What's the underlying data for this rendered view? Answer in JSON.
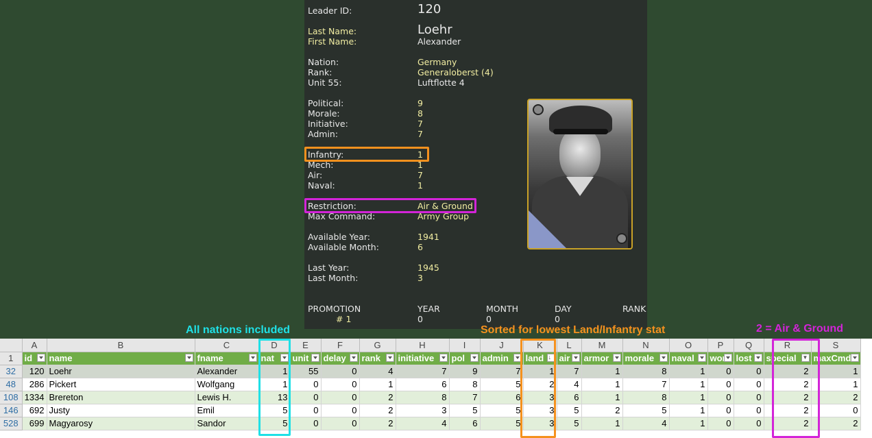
{
  "leader": {
    "leader_id_label": "Leader ID:",
    "leader_id": "120",
    "last_name_label": "Last Name:",
    "last_name": "Loehr",
    "first_name_label": "First Name:",
    "first_name": "Alexander",
    "nation_label": "Nation:",
    "nation": "Germany",
    "rank_label": "Rank:",
    "rank": "Generaloberst (4)",
    "unit_label": "Unit 55:",
    "unit": "Luftflotte 4",
    "political_label": "Political:",
    "political": "9",
    "morale_label": "Morale:",
    "morale": "8",
    "initiative_label": "Initiative:",
    "initiative": "7",
    "admin_label": "Admin:",
    "admin": "7",
    "infantry_label": "Infantry:",
    "infantry": "1",
    "mech_label": "Mech:",
    "mech": "1",
    "air_label": "Air:",
    "air": "7",
    "naval_label": "Naval:",
    "naval": "1",
    "restriction_label": "Restriction:",
    "restriction": "Air & Ground",
    "max_command_label": "Max Command:",
    "max_command": "Army Group",
    "avail_year_label": "Available Year:",
    "avail_year": "1941",
    "avail_month_label": "Available Month:",
    "avail_month": "6",
    "last_year_label": "Last Year:",
    "last_year": "1945",
    "last_month_label": "Last Month:",
    "last_month": "3",
    "promo_header": "PROMOTION",
    "year_header": "YEAR",
    "month_header": "MONTH",
    "day_header": "DAY",
    "rank_header": "RANK",
    "promo_num": "# 1",
    "promo_year": "0",
    "promo_month": "0",
    "promo_day": "0"
  },
  "annotations": {
    "nations": "All nations included",
    "sorted": "Sorted for lowest Land/Infantry stat",
    "special": "2 = Air & Ground"
  },
  "colors": {
    "orange": "#f5911e",
    "magenta": "#d324d8",
    "cyan": "#1fe0e6",
    "header_green": "#70ad47"
  },
  "sheet": {
    "column_letters": [
      "A",
      "B",
      "C",
      "D",
      "E",
      "F",
      "G",
      "H",
      "I",
      "J",
      "K",
      "L",
      "M",
      "N",
      "O",
      "P",
      "Q",
      "R",
      "S"
    ],
    "header_row_num": "1",
    "fields": [
      "id",
      "name",
      "fname",
      "nat",
      "unit",
      "delay",
      "rank",
      "initiative",
      "pol",
      "admin",
      "land",
      "air",
      "armor",
      "morale",
      "naval",
      "won",
      "lost",
      "special",
      "maxCmd"
    ],
    "rows": [
      {
        "rownum": "32",
        "cells": [
          "120",
          "Loehr",
          "Alexander",
          "1",
          "55",
          "0",
          "4",
          "7",
          "9",
          "7",
          "1",
          "7",
          "1",
          "8",
          "1",
          "0",
          "0",
          "2",
          "1"
        ]
      },
      {
        "rownum": "48",
        "cells": [
          "286",
          "Pickert",
          "Wolfgang",
          "1",
          "0",
          "0",
          "1",
          "6",
          "8",
          "5",
          "2",
          "4",
          "1",
          "7",
          "1",
          "0",
          "0",
          "2",
          "1"
        ]
      },
      {
        "rownum": "108",
        "cells": [
          "1334",
          "Brereton",
          "Lewis H.",
          "13",
          "0",
          "0",
          "2",
          "8",
          "7",
          "6",
          "3",
          "6",
          "1",
          "8",
          "1",
          "0",
          "0",
          "2",
          "2"
        ]
      },
      {
        "rownum": "146",
        "cells": [
          "692",
          "Justy",
          "Emil",
          "5",
          "0",
          "0",
          "2",
          "3",
          "5",
          "5",
          "3",
          "5",
          "2",
          "5",
          "1",
          "0",
          "0",
          "2",
          "0"
        ]
      },
      {
        "rownum": "528",
        "cells": [
          "699",
          "Magyarosy",
          "Sandor",
          "5",
          "0",
          "0",
          "2",
          "4",
          "6",
          "5",
          "3",
          "5",
          "1",
          "4",
          "1",
          "0",
          "0",
          "2",
          "2"
        ]
      }
    ]
  }
}
